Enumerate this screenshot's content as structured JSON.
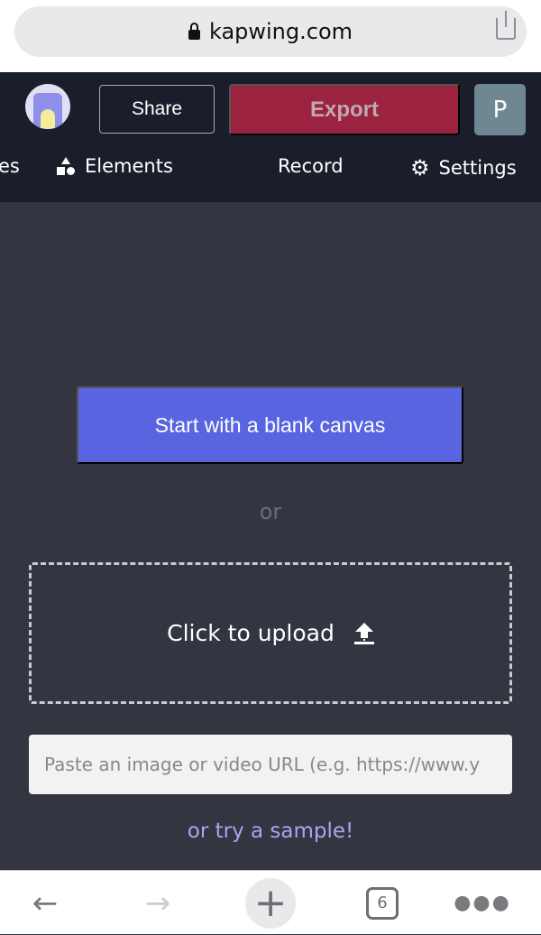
{
  "browser": {
    "url": "kapwing.com",
    "tab_count": "6",
    "icons": [
      "lock-icon",
      "share-icon",
      "back-icon",
      "forward-icon",
      "new-tab-icon",
      "tabs-icon",
      "more-icon"
    ]
  },
  "header": {
    "share_label": "Share",
    "export_label": "Export",
    "user_initial": "P"
  },
  "nav": {
    "partial_tab": "es",
    "elements": "Elements",
    "record": "Record",
    "settings": "Settings"
  },
  "main": {
    "blank_canvas": "Start with a blank canvas",
    "or": "or",
    "upload": "Click to upload",
    "url_placeholder": "Paste an image or video URL (e.g. https://www.y",
    "sample": "or try a sample!"
  },
  "colors": {
    "nav_bg": "#1a1e2b",
    "main_bg": "#333541",
    "primary": "#5965e0",
    "export": "#9b2340"
  }
}
